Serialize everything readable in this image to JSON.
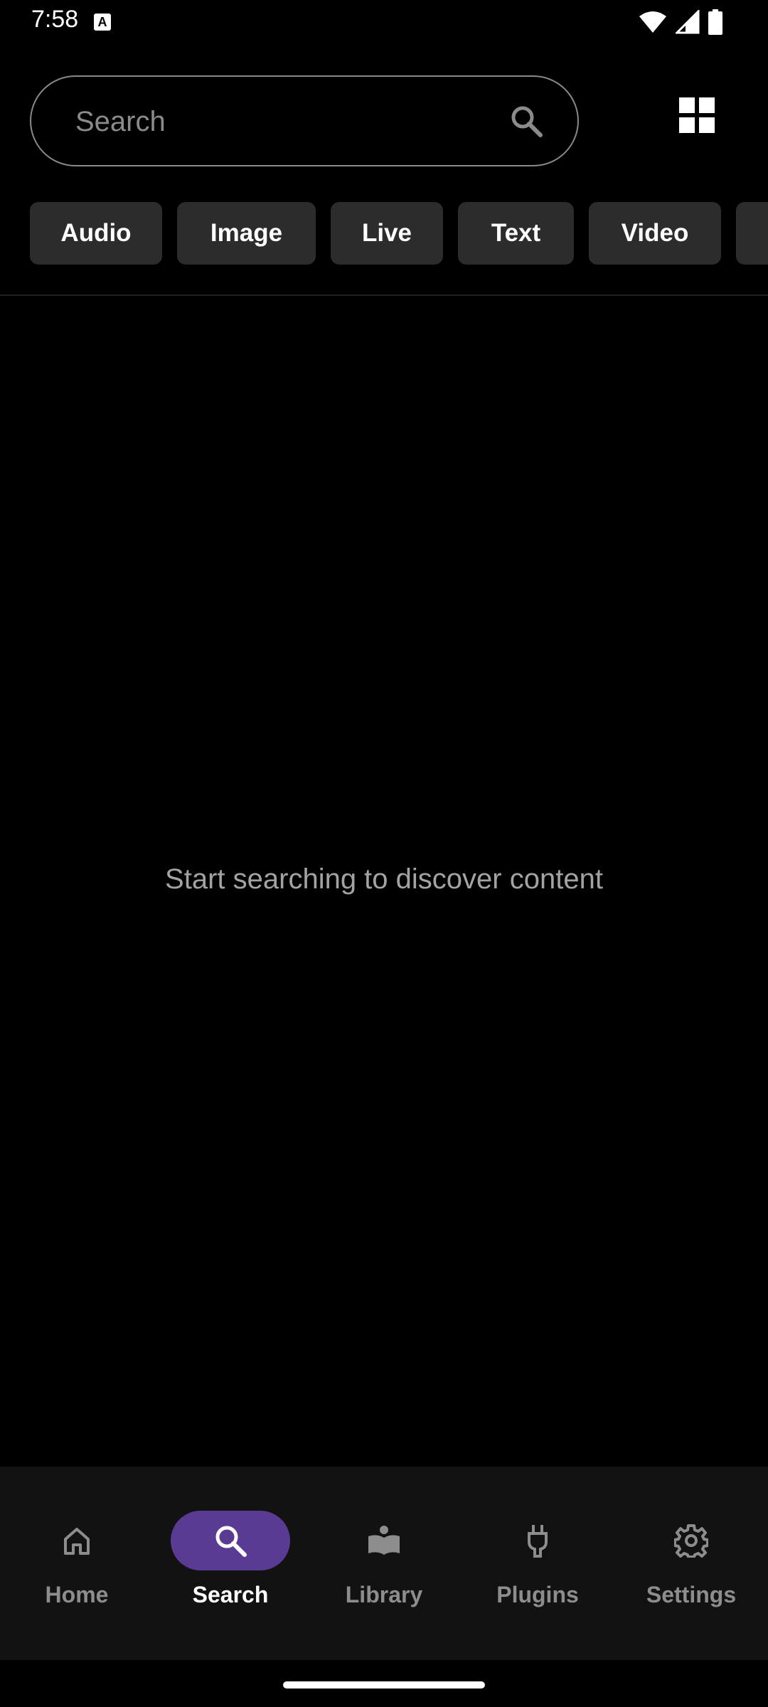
{
  "status_bar": {
    "time": "7:58",
    "notification_icon": "a-badge-icon",
    "icons": [
      "wifi-icon",
      "signal-icon",
      "battery-icon"
    ]
  },
  "search": {
    "placeholder": "Search",
    "value": "",
    "icon": "search-icon"
  },
  "toolbar": {
    "grid_icon": "grid-view-icon"
  },
  "chips": [
    {
      "label": "Audio"
    },
    {
      "label": "Image"
    },
    {
      "label": "Live"
    },
    {
      "label": "Text"
    },
    {
      "label": "Video"
    },
    {
      "label": ""
    }
  ],
  "main": {
    "empty_message": "Start searching to discover content"
  },
  "bottom_nav": {
    "items": [
      {
        "label": "Home",
        "icon": "home-icon",
        "active": false
      },
      {
        "label": "Search",
        "icon": "search-icon",
        "active": true
      },
      {
        "label": "Library",
        "icon": "library-icon",
        "active": false
      },
      {
        "label": "Plugins",
        "icon": "plug-icon",
        "active": false
      },
      {
        "label": "Settings",
        "icon": "gear-icon",
        "active": false
      }
    ]
  },
  "colors": {
    "background": "#000000",
    "nav_background": "#121212",
    "accent": "#5a3b94",
    "chip_background": "#2c2c2c",
    "muted_text": "#8d8d8d"
  }
}
